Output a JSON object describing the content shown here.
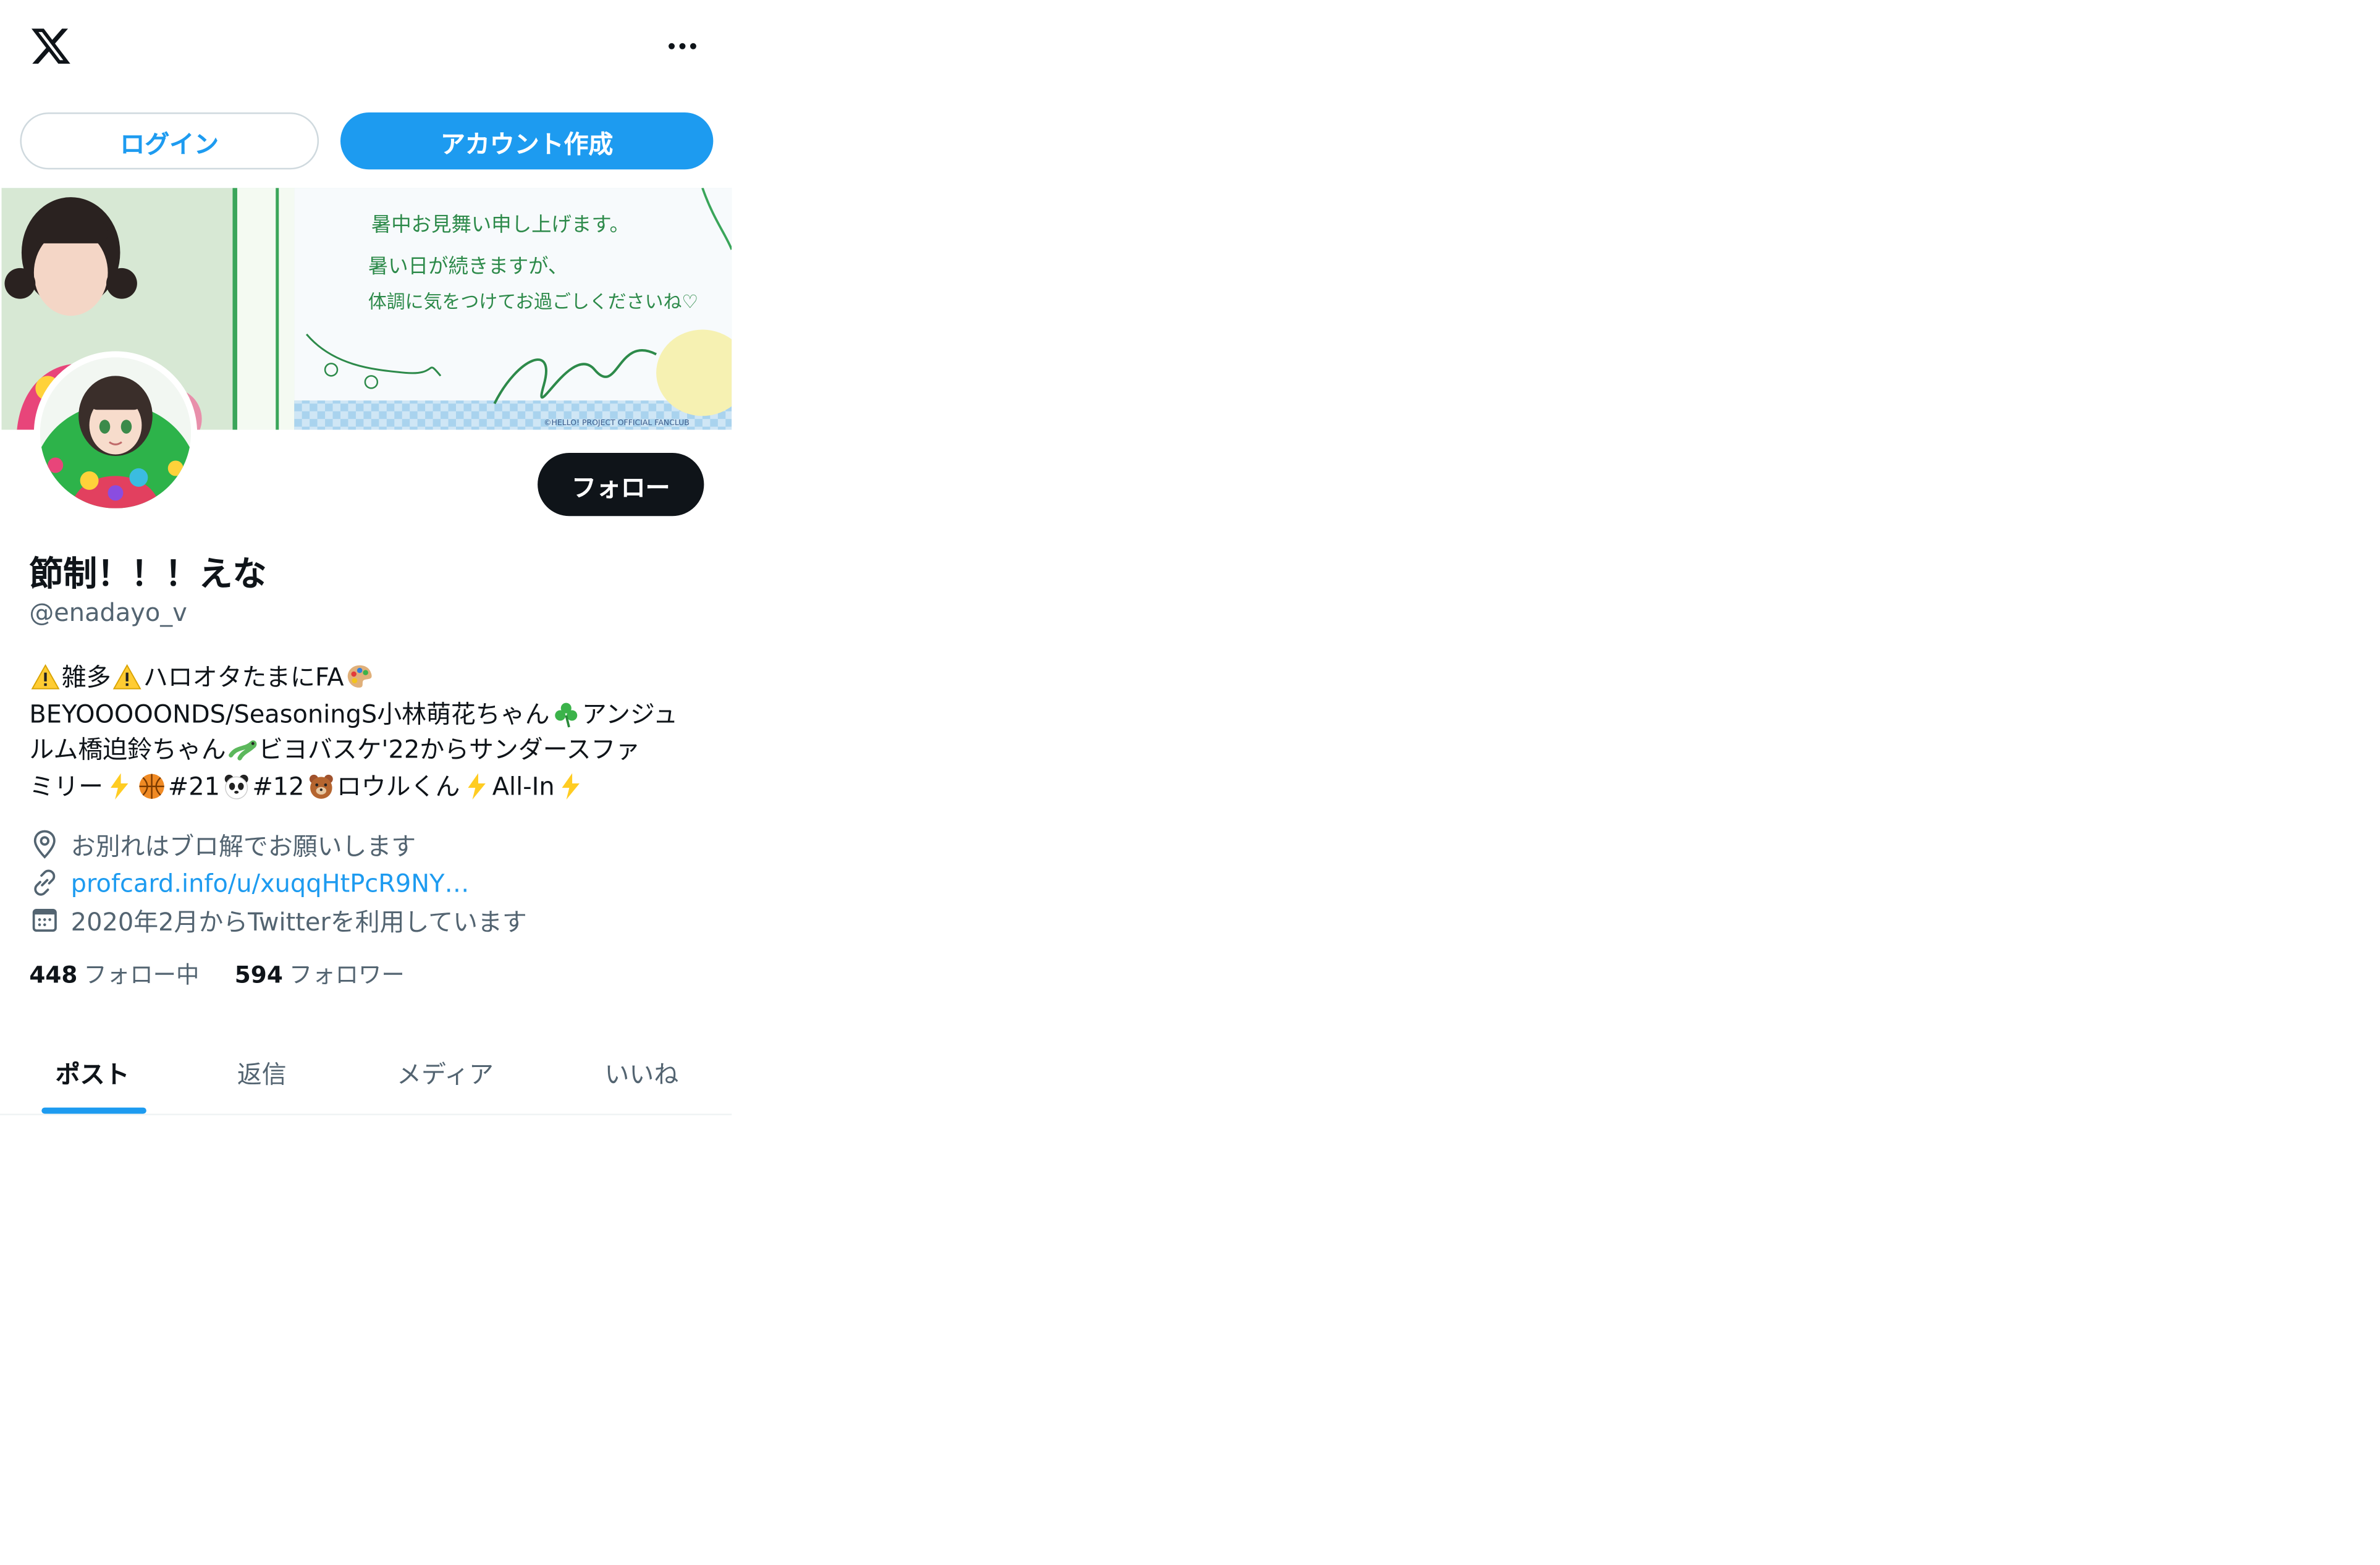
{
  "colors": {
    "accent": "#1d9bf0",
    "text": "#0f1419",
    "secondary": "#536471",
    "follow_bg": "#0f1419"
  },
  "header": {
    "logo_icon": "x-logo-icon",
    "more_icon": "more-horizontal-icon"
  },
  "auth": {
    "login_label": "ログイン",
    "signup_label": "アカウント作成"
  },
  "profile": {
    "follow_label": "フォロー",
    "display_name": "節制！！！えな",
    "handle": "@enadayo_v",
    "bio": {
      "line1": {
        "a": "雑多",
        "b": "ハロオタたまにFA"
      },
      "line2": {
        "a": "BEYOOOOONDS/SeasoningS小林萌花ちゃん",
        "b": "アンジュ"
      },
      "line3": {
        "a": "ルム橋迫鈴ちゃん",
        "b": "ビヨバスケ'22からサンダースファ"
      },
      "line4": {
        "a": "ミリー",
        "b": "#21",
        "c": " #12",
        "d": "ロウルくん",
        "e": "All-In"
      }
    },
    "location": "お別れはブロ解でお願いします",
    "link": "profcard.info/u/xuqqHtPcR9NY…",
    "joined": "2020年2月からTwitterを利用しています",
    "following_count": "448",
    "following_label": "フォロー中",
    "followers_count": "594",
    "followers_label": "フォロワー"
  },
  "tabs": [
    {
      "label": "ポスト",
      "active": true
    },
    {
      "label": "返信",
      "active": false
    },
    {
      "label": "メディア",
      "active": false
    },
    {
      "label": "いいね",
      "active": false
    }
  ],
  "banner": {
    "handwriting": {
      "line1": "暑中お見舞い申し上げます。",
      "line2": "暑い日が続きますが、",
      "line3": "体調に気をつけてお過ごしくださいね♡",
      "footer": "©HELLO! PROJECT OFFICIAL FANCLUB"
    }
  }
}
